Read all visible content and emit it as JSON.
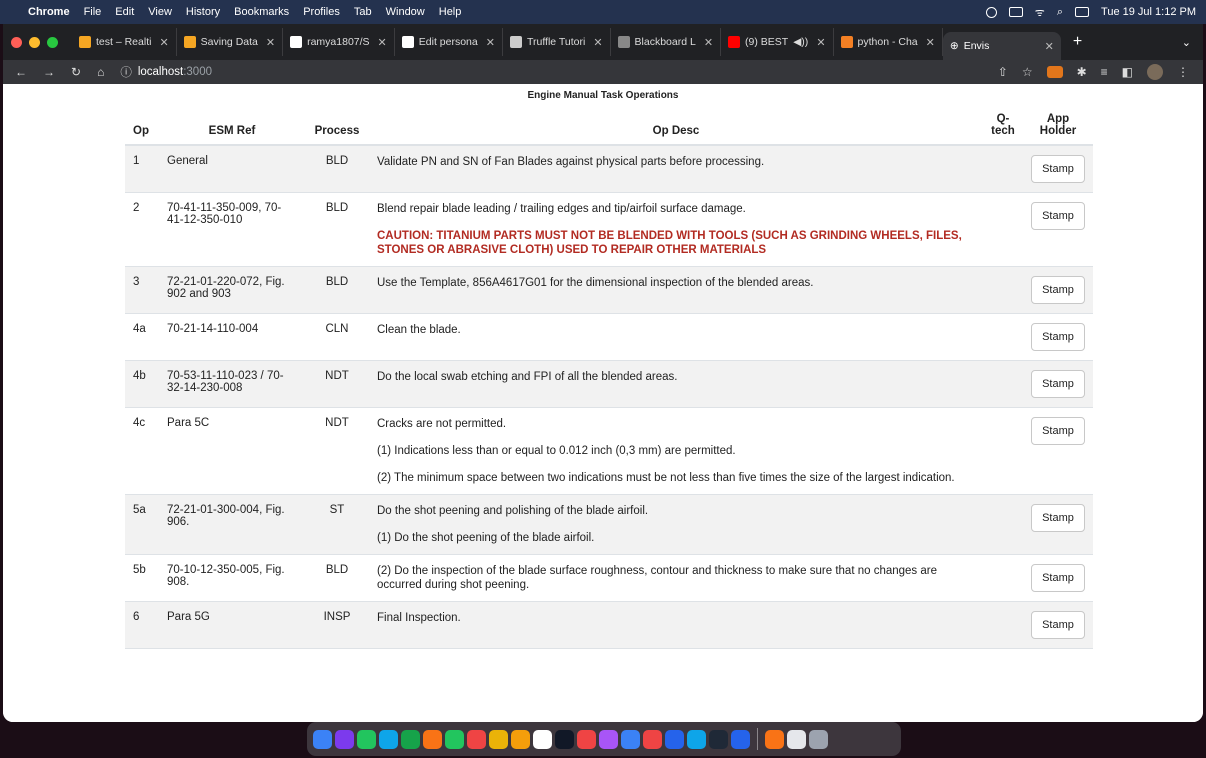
{
  "menubar": {
    "app": "Chrome",
    "items": [
      "File",
      "Edit",
      "View",
      "History",
      "Bookmarks",
      "Profiles",
      "Tab",
      "Window",
      "Help"
    ],
    "clock": "Tue 19 Jul  1:12 PM"
  },
  "tabs": [
    {
      "title": "test – Realti",
      "color": "#f5a623"
    },
    {
      "title": "Saving Data",
      "color": "#f5a623"
    },
    {
      "title": "ramya1807/S",
      "color": "#ffffff"
    },
    {
      "title": "Edit persona",
      "color": "#ffffff"
    },
    {
      "title": "Truffle Tutori",
      "color": "#cccccc"
    },
    {
      "title": "Blackboard L",
      "color": "#888888"
    },
    {
      "title": "(9) BEST",
      "color": "#ff0000"
    },
    {
      "title": "python - Cha",
      "color": "#f48024"
    }
  ],
  "active_tab": {
    "title": "Envis"
  },
  "address": {
    "host": "localhost",
    "port": ":3000"
  },
  "page": {
    "title": "Engine Manual Task Operations",
    "headers": {
      "op": "Op",
      "ref": "ESM Ref",
      "process": "Process",
      "desc": "Op Desc",
      "qtech": "Q-tech",
      "app": "App Holder"
    },
    "stamp_label": "Stamp",
    "rows": [
      {
        "op": "1",
        "ref": "General",
        "process": "BLD",
        "desc": [
          "Validate PN and SN of Fan Blades against physical parts before processing."
        ]
      },
      {
        "op": "2",
        "ref": "70-41-11-350-009, 70-41-12-350-010",
        "process": "BLD",
        "desc": [
          "Blend repair blade leading / trailing edges and tip/airfoil surface damage."
        ],
        "caution": "CAUTION: TITANIUM PARTS MUST NOT BE BLENDED WITH TOOLS (SUCH AS GRINDING WHEELS, FILES, STONES OR ABRASIVE CLOTH) USED TO REPAIR OTHER MATERIALS"
      },
      {
        "op": "3",
        "ref": "72-21-01-220-072, Fig. 902 and 903",
        "process": "BLD",
        "desc": [
          "Use the Template, 856A4617G01 for the dimensional inspection of the blended areas."
        ]
      },
      {
        "op": "4a",
        "ref": "70-21-14-110-004",
        "process": "CLN",
        "desc": [
          "Clean the blade."
        ]
      },
      {
        "op": "4b",
        "ref": "70-53-11-110-023 / 70-32-14-230-008",
        "process": "NDT",
        "desc": [
          "Do the local swab etching and FPI of all the blended areas."
        ]
      },
      {
        "op": "4c",
        "ref": "Para 5C",
        "process": "NDT",
        "desc": [
          "Cracks are not permitted.",
          "(1) Indications less than or equal to 0.012 inch (0,3 mm) are permitted.",
          "(2) The minimum space between two indications must be not less than five times the size of the largest indication."
        ]
      },
      {
        "op": "5a",
        "ref": "72-21-01-300-004, Fig. 906.",
        "process": "ST",
        "desc": [
          "Do the shot peening and polishing of the blade airfoil.",
          "(1) Do the shot peening of the blade airfoil."
        ]
      },
      {
        "op": "5b",
        "ref": "70-10-12-350-005, Fig. 908.",
        "process": "BLD",
        "desc": [
          "(2) Do the inspection of the blade surface roughness, contour and thickness to make sure that no changes are occurred during shot peening."
        ]
      },
      {
        "op": "6",
        "ref": "Para 5G",
        "process": "INSP",
        "desc": [
          "Final Inspection."
        ]
      }
    ]
  },
  "dock_colors": [
    "#3b82f6",
    "#7c3aed",
    "#22c55e",
    "#0ea5e9",
    "#16a34a",
    "#f97316",
    "#22c55e",
    "#ef4444",
    "#eab308",
    "#f59e0b",
    "#ffffff",
    "#111827",
    "#ef4444",
    "#a855f7",
    "#3b82f6",
    "#ef4444",
    "#2563eb",
    "#0ea5e9",
    "#1f2937",
    "#2563eb",
    "#f97316",
    "#e5e7eb",
    "#9ca3af"
  ]
}
